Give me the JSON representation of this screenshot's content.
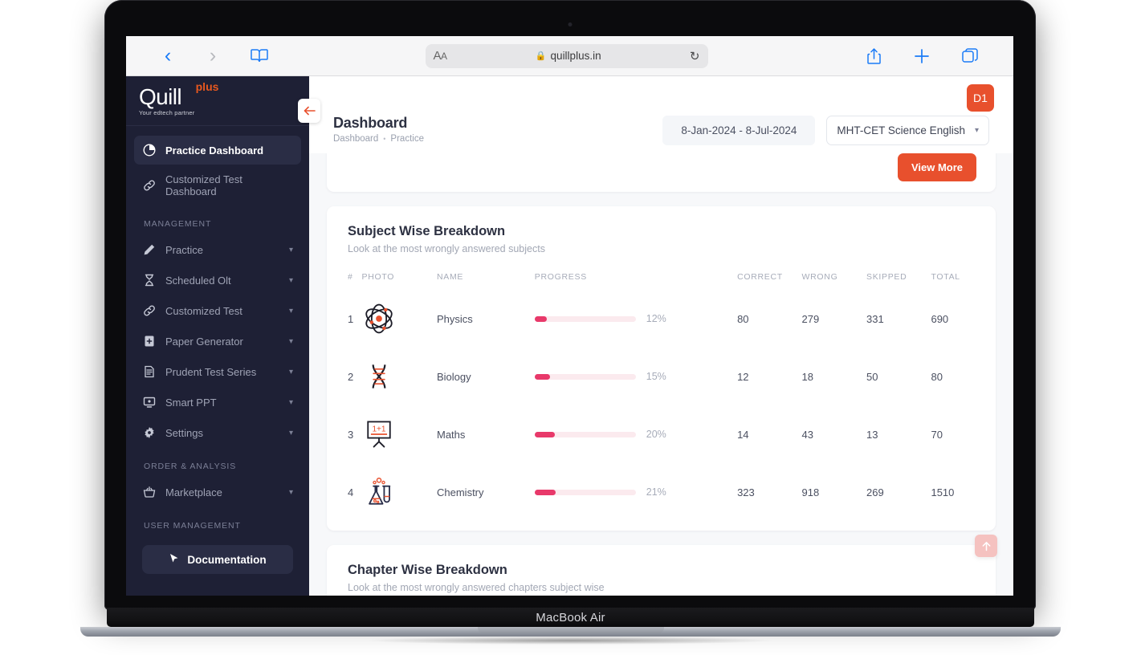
{
  "device": {
    "model": "MacBook Air"
  },
  "browser": {
    "back_icon": "chevron-left-icon",
    "forward_icon": "chevron-right-icon",
    "sidebar_icon": "book-icon",
    "text_size_label": "AA",
    "lock_icon": "lock-icon",
    "url": "quillplus.in",
    "reload_icon": "reload-icon",
    "share_icon": "share-icon",
    "new_tab_icon": "plus-icon",
    "tabs_icon": "tabs-icon"
  },
  "sidebar": {
    "logo": {
      "name": "Quill",
      "suffix": "plus",
      "tagline": "Your edtech partner"
    },
    "collapse_icon": "arrow-left-icon",
    "primary_items": [
      {
        "label": "Practice Dashboard",
        "icon": "pie-chart-icon",
        "active": true,
        "expandable": false
      },
      {
        "label": "Customized Test Dashboard",
        "icon": "link-icon",
        "active": false,
        "expandable": false
      }
    ],
    "sections": [
      {
        "title": "MANAGEMENT",
        "items": [
          {
            "label": "Practice",
            "icon": "pencil-icon",
            "expandable": true
          },
          {
            "label": "Scheduled Olt",
            "icon": "hourglass-icon",
            "expandable": true
          },
          {
            "label": "Customized Test",
            "icon": "link-icon",
            "expandable": true
          },
          {
            "label": "Paper Generator",
            "icon": "file-plus-icon",
            "expandable": true
          },
          {
            "label": "Prudent Test Series",
            "icon": "document-list-icon",
            "expandable": true
          },
          {
            "label": "Smart PPT",
            "icon": "presentation-icon",
            "expandable": true
          },
          {
            "label": "Settings",
            "icon": "gear-icon",
            "expandable": true
          }
        ]
      },
      {
        "title": "ORDER & ANALYSIS",
        "items": [
          {
            "label": "Marketplace",
            "icon": "basket-icon",
            "expandable": true
          }
        ]
      },
      {
        "title": "USER MANAGEMENT",
        "items": []
      }
    ],
    "documentation_button": {
      "label": "Documentation",
      "icon": "cursor-icon"
    }
  },
  "header": {
    "title": "Dashboard",
    "breadcrumb": [
      "Dashboard",
      "Practice"
    ],
    "breadcrumb_separator": "•",
    "date_range": "8-Jan-2024 - 8-Jul-2024",
    "course_select": {
      "value": "MHT-CET Science English",
      "chevron_icon": "chevron-down-icon"
    },
    "avatar": {
      "initials": "D1",
      "color": "#e8502d"
    }
  },
  "top_card": {
    "view_more_label": "View More"
  },
  "subject_card": {
    "title": "Subject Wise Breakdown",
    "subtitle": "Look at the most wrongly answered subjects",
    "columns": [
      "#",
      "PHOTO",
      "NAME",
      "PROGRESS",
      "CORRECT",
      "WRONG",
      "SKIPPED",
      "TOTAL"
    ],
    "rows": [
      {
        "index": "1",
        "icon": "atom-icon",
        "name": "Physics",
        "progress_pct": 12,
        "progress_label": "12%",
        "correct": "80",
        "wrong": "279",
        "skipped": "331",
        "total": "690"
      },
      {
        "index": "2",
        "icon": "dna-icon",
        "name": "Biology",
        "progress_pct": 15,
        "progress_label": "15%",
        "correct": "12",
        "wrong": "18",
        "skipped": "50",
        "total": "80"
      },
      {
        "index": "3",
        "icon": "board-icon",
        "name": "Maths",
        "progress_pct": 20,
        "progress_label": "20%",
        "correct": "14",
        "wrong": "43",
        "skipped": "13",
        "total": "70"
      },
      {
        "index": "4",
        "icon": "flask-icon",
        "name": "Chemistry",
        "progress_pct": 21,
        "progress_label": "21%",
        "correct": "323",
        "wrong": "918",
        "skipped": "269",
        "total": "1510"
      }
    ]
  },
  "chapter_card": {
    "title": "Chapter Wise Breakdown",
    "subtitle": "Look at the most wrongly answered chapters subject wise"
  },
  "scroll_top_button": {
    "icon": "arrow-up-icon"
  },
  "colors": {
    "accent": "#e8502d",
    "progress": "#e8396a",
    "progress_track": "#fbeaee",
    "sidebar_bg": "#1e2035",
    "page_bg": "#f7f8fa"
  }
}
